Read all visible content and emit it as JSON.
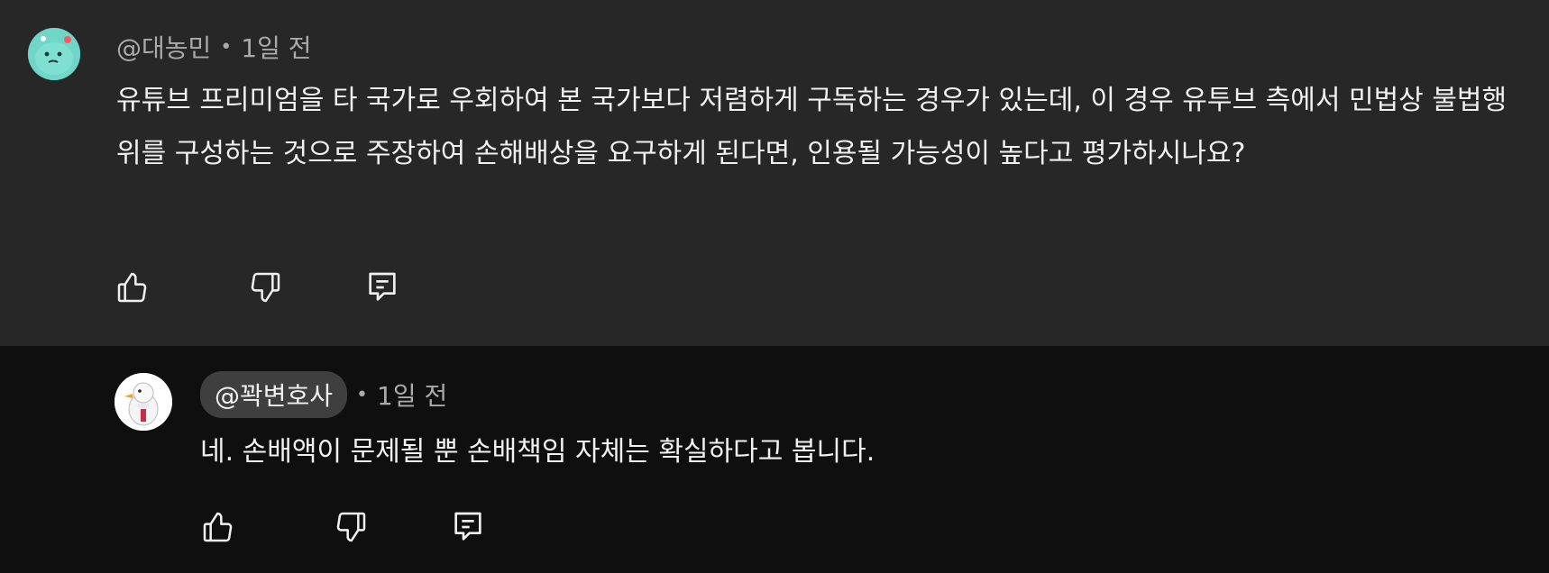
{
  "comments": [
    {
      "handle": "@대농민",
      "separator": "•",
      "time": "1일 전",
      "body": "유튜브 프리미엄을 타 국가로 우회하여 본 국가보다 저렴하게 구독하는 경우가 있는데, 이 경우 유투브 측에서 민법상 불법행위를 구성하는 것으로 주장하여 손해배상을 요구하게 된다면, 인용될 가능성이 높다고 평가하시나요?",
      "avatar_color": "#5fd3c2"
    },
    {
      "handle": "@꽉변호사",
      "separator": "•",
      "time": "1일 전",
      "body": "네. 손배액이 문제될 뿐 손배책임 자체는 확실하다고 봅니다.",
      "avatar_color": "#ffffff"
    }
  ],
  "icons": {
    "like": "thumbs-up-icon",
    "dislike": "thumbs-down-icon",
    "reply": "reply-icon"
  },
  "colors": {
    "top_background": "#272727",
    "reply_background": "#0f0f0f",
    "text": "#f1f1f1",
    "muted": "#aaaaaa",
    "pill": "#3f3f3f"
  }
}
